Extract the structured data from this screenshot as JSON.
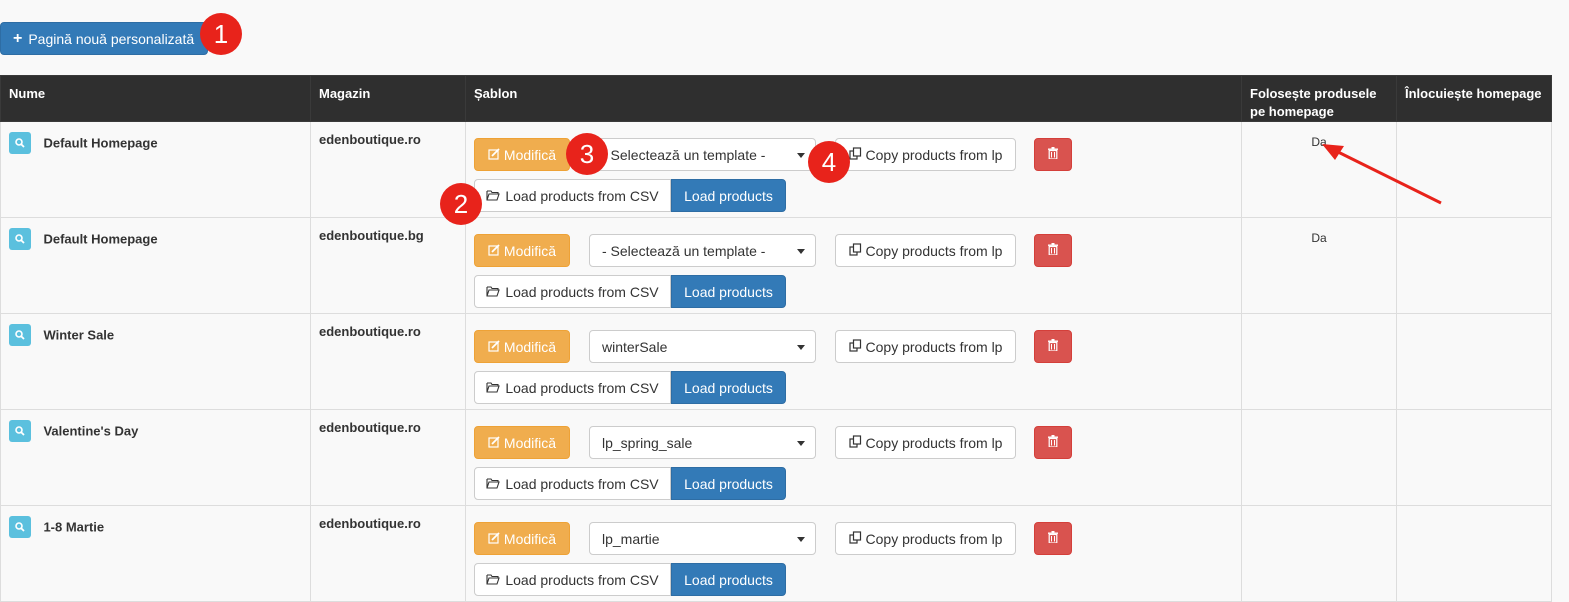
{
  "toolbar": {
    "new_page_label": "Pagină nouă personalizată"
  },
  "badges": [
    "1",
    "2",
    "3",
    "4"
  ],
  "table": {
    "headers": {
      "name": "Nume",
      "store": "Magazin",
      "template": "Șablon",
      "uses_products": "Folosește produsele pe homepage",
      "replaces_homepage": "Înlocuiește homepage"
    },
    "rows": [
      {
        "name": "Default Homepage",
        "store": "edenboutique.ro",
        "template_value": "- Selectează un template -",
        "uses_products": "Da",
        "replaces_homepage": ""
      },
      {
        "name": "Default Homepage",
        "store": "edenboutique.bg",
        "template_value": "- Selectează un template -",
        "uses_products": "Da",
        "replaces_homepage": ""
      },
      {
        "name": "Winter Sale",
        "store": "edenboutique.ro",
        "template_value": "winterSale",
        "uses_products": "",
        "replaces_homepage": ""
      },
      {
        "name": "Valentine's Day",
        "store": "edenboutique.ro",
        "template_value": "lp_spring_sale",
        "uses_products": "",
        "replaces_homepage": ""
      },
      {
        "name": "1-8 Martie",
        "store": "edenboutique.ro",
        "template_value": "lp_martie",
        "uses_products": "",
        "replaces_homepage": ""
      }
    ]
  },
  "actions": {
    "modify_label": "Modifică",
    "copy_label": "Copy products from lp",
    "csv_label": "Load products from CSV",
    "load_label": "Load products"
  },
  "colors": {
    "primary": "#337ab7",
    "warning": "#f0ad4e",
    "danger": "#d9534f",
    "info": "#5bc0de",
    "header_bg": "#2f2f2f",
    "annotation": "#e8231b"
  },
  "icons": [
    "plus-icon",
    "search-icon",
    "edit-icon",
    "copy-icon",
    "folder-open-icon",
    "trash-icon",
    "chevron-down-icon"
  ]
}
